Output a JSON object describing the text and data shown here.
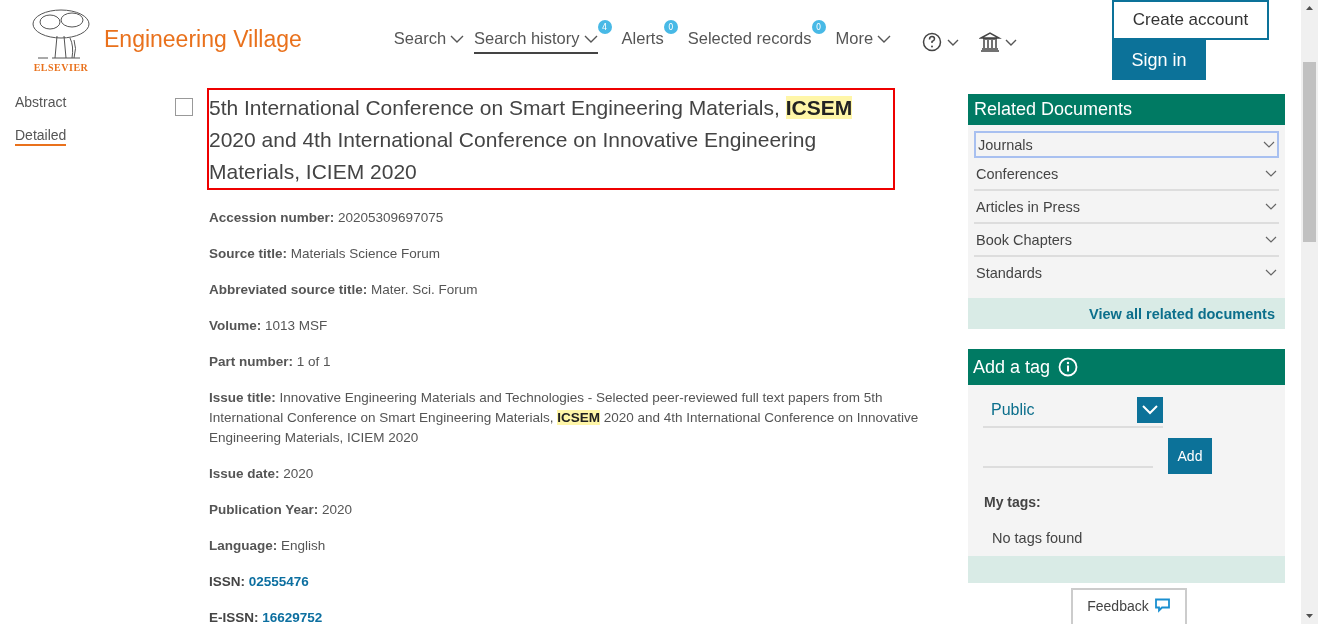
{
  "header": {
    "logo_word": "ELSEVIER",
    "brand": "Engineering Village",
    "nav": [
      {
        "label": "Search",
        "dropdown": true,
        "selected": false
      },
      {
        "label": "Search history",
        "dropdown": true,
        "selected": true,
        "badge": "4"
      },
      {
        "label": "Alerts",
        "dropdown": false,
        "selected": false,
        "badge": "0"
      },
      {
        "label": "Selected records",
        "dropdown": false,
        "selected": false,
        "badge": "0"
      },
      {
        "label": "More",
        "dropdown": true,
        "selected": false
      }
    ],
    "create_account": "Create account",
    "sign_in": "Sign in"
  },
  "left_nav": [
    {
      "label": "Abstract",
      "selected": false
    },
    {
      "label": "Detailed",
      "selected": true
    }
  ],
  "record": {
    "checked": false,
    "title": "5th International Conference on Smart Engineering Materials, **ICSEM** 2020 and 4th International Conference on Innovative Engineering Materials, ICIEM 2020",
    "fields": [
      {
        "kind": "text",
        "text": "**Accession number:** 20205309697075"
      },
      {
        "kind": "text",
        "text": "**Source title:** Materials Science Forum"
      },
      {
        "kind": "text",
        "text": "**Abbreviated source title:** Mater. Sci. Forum"
      },
      {
        "kind": "text",
        "text": "**Volume:** 1013 MSF"
      },
      {
        "kind": "text",
        "text": "**Part number:** 1 of 1"
      },
      {
        "kind": "text",
        "text": "**Issue title:** Innovative Engineering Materials and Technologies - Selected peer-reviewed full text papers from 5th International Conference on Smart Engineering Materials, **ICSEM** 2020 and 4th International Conference on Innovative Engineering Materials, ICIEM 2020"
      },
      {
        "kind": "text",
        "text": "**Issue date:** 2020"
      },
      {
        "kind": "text",
        "text": "**Publication Year:** 2020"
      },
      {
        "kind": "text",
        "text": "**Language:** English"
      },
      {
        "kind": "link",
        "label": "ISSN:",
        "value": "02555476"
      },
      {
        "kind": "link",
        "label": "E-ISSN:",
        "value": "16629752"
      }
    ]
  },
  "related": {
    "title": "Related Documents",
    "items": [
      {
        "label": "Journals",
        "selected": true
      },
      {
        "label": "Conferences",
        "selected": false
      },
      {
        "label": "Articles in Press",
        "selected": false
      },
      {
        "label": "Book Chapters",
        "selected": false
      },
      {
        "label": "Standards",
        "selected": false
      }
    ],
    "view_all": "View all related documents"
  },
  "tags": {
    "title": "Add a tag",
    "visibility": "Public",
    "add": "Add",
    "my_tags": "My tags:",
    "empty": "No tags found"
  },
  "feedback": "Feedback"
}
